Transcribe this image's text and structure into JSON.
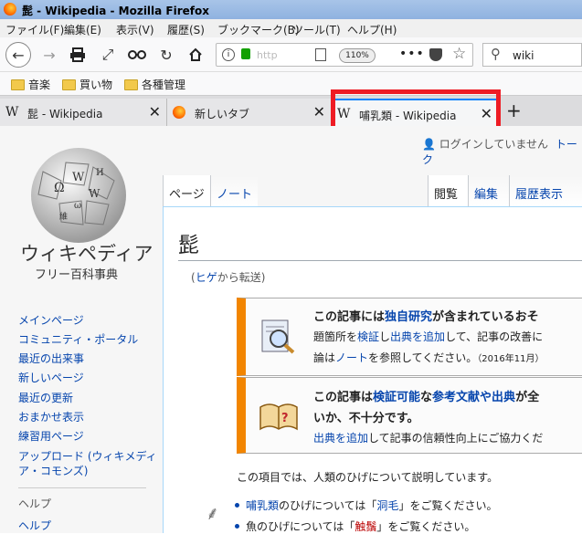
{
  "window": {
    "title": "髭 - Wikipedia - Mozilla Firefox"
  },
  "menu": [
    "ファイル(F)",
    "編集(E)",
    "表示(V)",
    "履歴(S)",
    "ブックマーク(B)",
    "ツール(T)",
    "ヘルプ(H)"
  ],
  "nav": {
    "url": "http",
    "zoom": "110%",
    "more": "•••",
    "search_value": "wiki"
  },
  "bookmarks": [
    "音楽",
    "買い物",
    "各種管理"
  ],
  "tabs": [
    {
      "label": "髭 - Wikipedia"
    },
    {
      "label": "新しいタブ"
    },
    {
      "label": "哺乳類 - Wikipedia"
    }
  ],
  "tab_close": "✕",
  "newtab": "+",
  "site": {
    "logo_text": "ウィキペディア",
    "logo_sub": "フリー百科事典",
    "login": "ログインしていません",
    "talk": "トーク"
  },
  "sidebar": {
    "items": [
      "メインページ",
      "コミュニティ・ポータル",
      "最近の出来事",
      "新しいページ",
      "最近の更新",
      "おまかせ表示",
      "練習用ページ",
      "アップロード (ウィキメディ",
      "ア・コモンズ)"
    ],
    "help_heading": "ヘルプ",
    "help_item": "ヘルプ"
  },
  "page_tabs": {
    "page": "ページ",
    "note": "ノート",
    "read": "閲覧",
    "edit": "編集",
    "history": "履歴表示"
  },
  "article": {
    "title": "髭",
    "redirect_pre": "(",
    "redirect_link": "ヒゲ",
    "redirect_post": "から転送)",
    "box1": {
      "l1a": "この記事には",
      "l1b": "独自研究",
      "l1c": "が含まれているおそ",
      "l2a": "題箇所を",
      "l2b": "検証",
      "l2c": "し",
      "l2d": "出典を追加",
      "l2e": "して、記事の改善に",
      "l3a": "論は",
      "l3b": "ノート",
      "l3c": "を参照してください。",
      "l3d": "（2016年11月）"
    },
    "box2": {
      "l1a": "この記事は",
      "l1b": "検証可能",
      "l1c": "な",
      "l1d": "参考文献や出典",
      "l1e": "が全",
      "l2": "いか、不十分です。",
      "l3a": "出典を追加",
      "l3b": "して記事の信頼性向上にご協力くだ"
    },
    "hatnote": "この項目では、人類のひげについて説明しています。",
    "bullet1": {
      "a": "哺乳類",
      "b": "のひげについては「",
      "c": "洞毛",
      "d": "」をご覧ください。"
    },
    "bullet2": {
      "a": "魚のひげについては「",
      "b": "触鬚",
      "c": "」をご覧ください。"
    }
  },
  "colors": {
    "accent": "#0a84ff",
    "highlight_box": "#ee1c24",
    "ambox_border": "#f28500",
    "link": "#0645ad"
  }
}
